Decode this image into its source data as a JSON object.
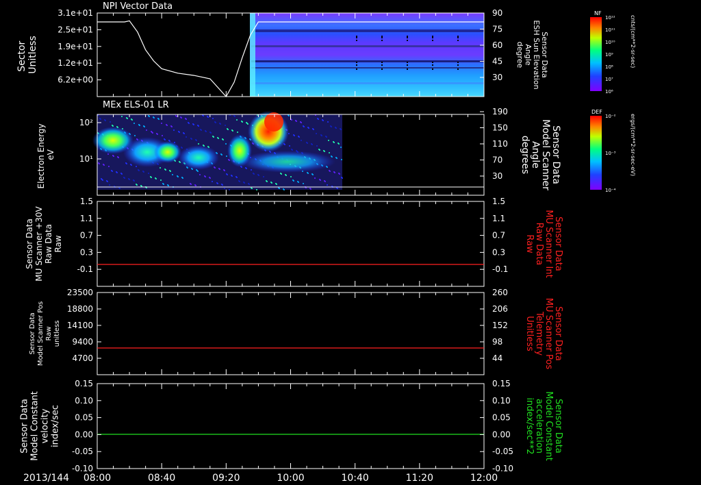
{
  "date_label": "2013/144",
  "x_ticks": [
    "08:00",
    "08:40",
    "09:20",
    "10:00",
    "10:40",
    "11:20",
    "12:00"
  ],
  "colors": {
    "axes": "#ffffff",
    "red": "#ff2020",
    "green": "#20e020",
    "background": "#000000"
  },
  "panels": [
    {
      "title": "NPI Vector Data",
      "left_label": [
        "Sector",
        "Unitless"
      ],
      "right_label": [
        "Sensor Data",
        "ESH Sun Elevation",
        "Angle",
        "degree"
      ],
      "right_label_color": "#ffffff",
      "y_ticks_left": [
        "3.1e+01",
        "2.5e+01",
        "1.9e+01",
        "1.2e+01",
        "6.2e+00"
      ],
      "y_ticks_right": [
        "90",
        "75",
        "60",
        "45",
        "30"
      ]
    },
    {
      "title": "MEx ELS-01 LR",
      "left_label": [
        "Electron Energy",
        "eV"
      ],
      "right_label": [
        "Sensor Data",
        "Model Scanner",
        "Angle",
        "degrees"
      ],
      "right_label_color": "#ffffff",
      "y_ticks_left": [
        "10²",
        "10¹"
      ],
      "y_ticks_right": [
        "190",
        "150",
        "110",
        "70",
        "30"
      ]
    },
    {
      "title": "",
      "left_label": [
        "Sensor Data",
        "MU Scanner +30V",
        "Raw Data",
        "Raw"
      ],
      "right_label": [
        "Sensor Data",
        "MU Scanner Int",
        "Raw Data",
        "Raw"
      ],
      "right_label_color": "#ff2020",
      "y_ticks_left": [
        "1.5",
        "1.1",
        "0.7",
        "0.3",
        "-0.1"
      ],
      "y_ticks_right": [
        "1.5",
        "1.1",
        "0.7",
        "0.3",
        "-0.1"
      ]
    },
    {
      "title": "",
      "left_label": [
        "Sensor Data",
        "Model Scanner Pos",
        "Raw",
        "unitless"
      ],
      "right_label": [
        "Sensor Data",
        "MU Scanner Pos",
        "Telemetry",
        "Unitless"
      ],
      "right_label_color": "#ff2020",
      "y_ticks_left": [
        "23500",
        "18800",
        "14100",
        "9400",
        "4700"
      ],
      "y_ticks_right": [
        "260",
        "206",
        "152",
        "98",
        "44"
      ]
    },
    {
      "title": "",
      "left_label": [
        "Sensor Data",
        "Model Constant",
        "velocity",
        "index/sec"
      ],
      "right_label": [
        "Sensor Data",
        "Model Constant",
        "acceleration",
        "index/sec**2"
      ],
      "right_label_color": "#20e020",
      "y_ticks_left": [
        "0.15",
        "0.10",
        "0.05",
        "0.00",
        "-0.05",
        "-0.10"
      ],
      "y_ticks_right": [
        "0.15",
        "0.10",
        "0.05",
        "0.00",
        "-0.05",
        "-0.10"
      ]
    }
  ],
  "colorbars": [
    {
      "title": "NF",
      "unit": "cnts/(cm**2-sr-sec)",
      "ticks": [
        "10¹²",
        "10¹¹",
        "10¹⁰",
        "10⁹",
        "10⁸",
        "10⁷",
        "10⁶"
      ]
    },
    {
      "title": "DEF",
      "unit": "ergs/(cm**2-sr-sec-eV)",
      "ticks": [
        "10⁻²",
        "10⁻³",
        "10⁻⁴"
      ]
    }
  ],
  "chart_data": [
    {
      "type": "line",
      "panel": "NPI Vector Data",
      "series": [
        {
          "name": "Sensor Data ESH Sun Elevation Angle",
          "x": [
            "08:00",
            "08:20",
            "08:30",
            "08:40",
            "08:50",
            "09:00",
            "09:10",
            "09:20",
            "09:30",
            "09:40",
            "10:00",
            "12:00"
          ],
          "values": [
            82,
            82,
            83,
            60,
            35,
            24,
            22,
            16,
            43,
            82,
            82,
            82
          ],
          "color": "#ffffff"
        }
      ],
      "heatmap": {
        "x_start": "09:30",
        "x_end": "12:00",
        "description_colors": [
          "#40e0ff",
          "#2060ff",
          "#6040ff",
          "#8040ff"
        ]
      }
    },
    {
      "type": "heatmap",
      "panel": "MEx ELS-01 LR",
      "x_range": [
        "08:00",
        "10:30"
      ],
      "line": {
        "name": "Model Scanner Angle",
        "value": 20,
        "color": "#ffffff"
      }
    },
    {
      "type": "line",
      "panel": 3,
      "ylim": [
        -0.3,
        1.5
      ],
      "series": [
        {
          "name": "MU Scanner Int Raw Data",
          "x": [
            "08:00",
            "12:00"
          ],
          "values": [
            0,
            0
          ],
          "color": "#ff2020"
        }
      ]
    },
    {
      "type": "line",
      "panel": 4,
      "ylim": [
        0,
        23500
      ],
      "series": [
        {
          "name": "MU Scanner Pos Telemetry",
          "x": [
            "08:00",
            "12:00"
          ],
          "values": [
            9400,
            9400
          ],
          "color": "#ff2020"
        }
      ]
    },
    {
      "type": "line",
      "panel": 5,
      "ylim": [
        -0.1,
        0.15
      ],
      "series": [
        {
          "name": "Model Constant acceleration",
          "x": [
            "08:00",
            "12:00"
          ],
          "values": [
            0,
            0
          ],
          "color": "#20e020"
        }
      ]
    }
  ]
}
